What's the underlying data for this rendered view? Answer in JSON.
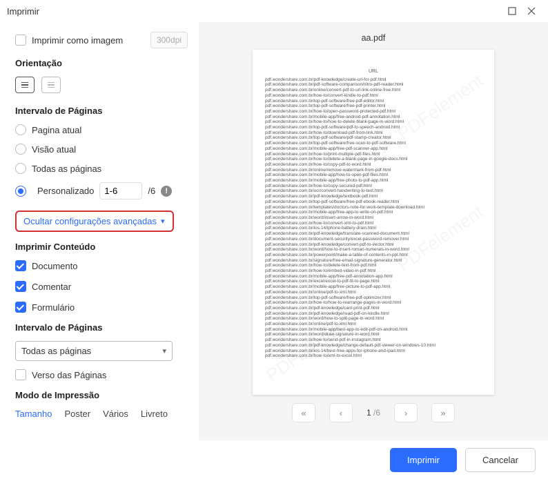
{
  "window": {
    "title": "Imprimir"
  },
  "sidebar": {
    "print_as_image": {
      "label": "Imprimir como imagem",
      "dpi_placeholder": "300dpi"
    },
    "orientation_h": "Orientação",
    "page_range_h": "Intervalo de Páginas",
    "range": {
      "current_page": "Pagina atual",
      "current_view": "Visão atual",
      "all_pages": "Todas as páginas",
      "custom_label": "Personalizado",
      "custom_value": "1-6",
      "total_suffix": "/6"
    },
    "advanced_toggle": "Ocultar configurações avançadas",
    "content_h": "Imprimir Conteúdo",
    "content": {
      "document": "Documento",
      "comment": "Comentar",
      "form": "Formulário"
    },
    "page_range_h2": "Intervalo de Páginas",
    "subset_select": "Todas as páginas",
    "reverse_pages": "Verso das Páginas",
    "mode_h": "Modo de Impressão",
    "tabs": {
      "size": "Tamanho",
      "poster": "Poster",
      "multiple": "Vários",
      "booklet": "Livreto"
    }
  },
  "preview": {
    "filename": "aa.pdf",
    "page_header": "URL",
    "urls": [
      "pdf.wondershare.com.br/pdf-knowledge/create-url-for-pdf.html",
      "pdf.wondershare.com.br/pdf-software-comparison/nitro-pdf-reader.html",
      "pdf.wondershare.com.br/online/convert-pdf-to-url-link-online-free.html",
      "pdf.wondershare.com.br/how-to/convert-kindle-to-pdf.html",
      "pdf.wondershare.com.br/top-pdf-software/free-pdf-editor.html",
      "pdf.wondershare.com.br/top-pdf-software/free-pdf-printer.html",
      "pdf.wondershare.com.br/how-to/open-password-protected-pdf.html",
      "pdf.wondershare.com.br/mobile-app/free-android-pdf-annotation.html",
      "pdf.wondershare.com.br/how-to/how-to-delete-blank-page-in-word.html",
      "pdf.wondershare.com.br/top-pdf-software/pdf-to-speech-android.html",
      "pdf.wondershare.com.br/how-to/download-pdf-from-link.html",
      "pdf.wondershare.com.br/top-pdf-software/pdf-stamp-creator.html",
      "pdf.wondershare.com.br/top-pdf-software/free-scan-to-pdf-software.html",
      "pdf.wondershare.com.br/mobile-app/free-pdf-scanner-app.html",
      "pdf.wondershare.com.br/how-to/print-multiple-pdf-files.html",
      "pdf.wondershare.com.br/how-to/delete-a-blank-page-in-google-docs.html",
      "pdf.wondershare.com.br/how-to/copy-pdf-to-word.html",
      "pdf.wondershare.com.br/online/remove-watermark-from-pdf.html",
      "pdf.wondershare.com.br/mobile-app/how-to-open-pdf-files.html",
      "pdf.wondershare.com.br/mobile-app/free-photo-to-pdf-app.html",
      "pdf.wondershare.com.br/how-to/copy-secured-pdf.html",
      "pdf.wondershare.com.br/ocr/convert-handwriting-to-text.html",
      "pdf.wondershare.com.br/pdf-knowledge/textbook-pdf.html",
      "pdf.wondershare.com.br/top-pdf-software/free-pdf-ebook-reader.html",
      "pdf.wondershare.com.br/templates/doctors-note-for-work-template-download.html",
      "pdf.wondershare.com.br/mobile-app/free-app-to-write-on-pdf.html",
      "pdf.wondershare.com.br/word/insert-arrow-in-word.html",
      "pdf.wondershare.com.br/how-to/convert-xml-to-pdf.html",
      "pdf.wondershare.com.br/ios-14/iphone-battery-drain.html",
      "pdf.wondershare.com.br/pdf-knowledge/translate-scanned-document.html",
      "pdf.wondershare.com.br/document-security/excel-password-remover.html",
      "pdf.wondershare.com.br/pdf-knowledge/convert-pdf-to-vector.html",
      "pdf.wondershare.com.br/word/how-to-insert-roman-numerals-in-word.html",
      "pdf.wondershare.com.br/powerpoint/make-a-table-of-contents-in-ppt.html",
      "pdf.wondershare.com.br/signature/free-email-signature-generator.html",
      "pdf.wondershare.com.br/how-to/delete-text-from-pdf.html",
      "pdf.wondershare.com.br/how-to/embed-video-in-pdf.html",
      "pdf.wondershare.com.br/mobile-app/free-pdf-annotation-app.html",
      "pdf.wondershare.com.br/excel/excel-to-pdf-fit-to-page.html",
      "pdf.wondershare.com.br/mobile-app/free-picture-to-pdf-app.html",
      "pdf.wondershare.com.br/online/pdf-to-xml.html",
      "pdf.wondershare.com.br/top-pdf-software/free-pdf-optimizer.html",
      "pdf.wondershare.com.br/how-to/how-to-rearrange-pages-in-word.html",
      "pdf.wondershare.com.br/pdf-knowledge/cant-print-pdf.html",
      "pdf.wondershare.com.br/pdf-knowledge/read-pdf-on-kindle.html",
      "pdf.wondershare.com.br/word/how-to-split-page-in-word.html",
      "pdf.wondershare.com.br/online/pdf-to-xml.html",
      "pdf.wondershare.com.br/mobile-app/best-app-to-edit-pdf-on-android.html",
      "pdf.wondershare.com.br/word/draw-signature-in-word.html",
      "pdf.wondershare.com.br/how-to/send-pdf-in-instagram.html",
      "pdf.wondershare.com.br/pdf-knowledge/change-default-pdf-viewer-on-windows-10.html",
      "pdf.wondershare.com.br/ios-14/best-free-apps-for-iphone-and-ipad.html",
      "pdf.wondershare.com.br/how-to/xml-to-excel.html"
    ],
    "watermark": "PDFelement",
    "pager": {
      "current": "1",
      "total": "/6"
    }
  },
  "footer": {
    "print": "Imprimir",
    "cancel": "Cancelar"
  }
}
